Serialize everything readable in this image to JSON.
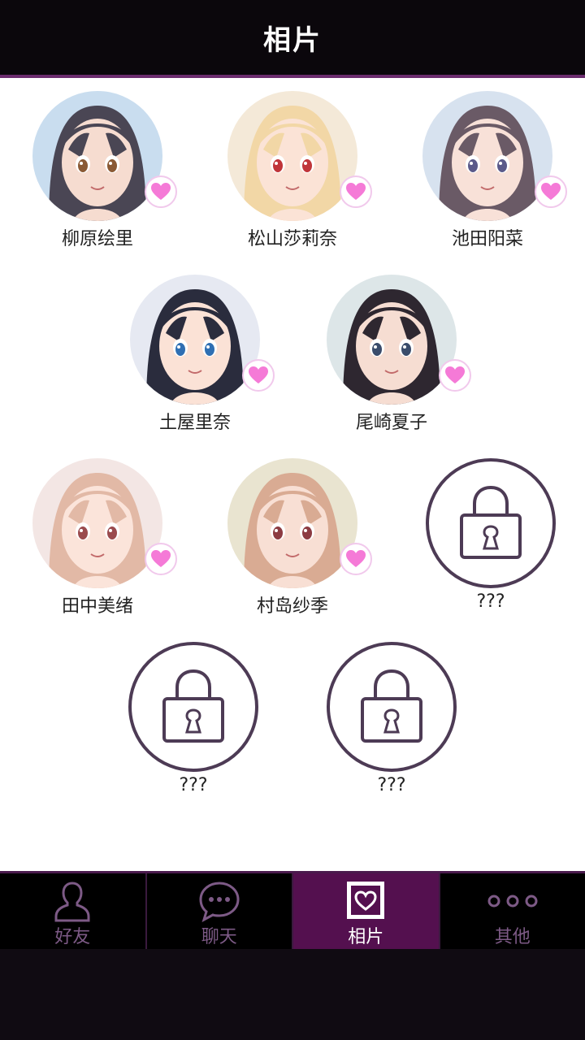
{
  "header": {
    "title": "相片"
  },
  "characters": [
    {
      "name": "柳原绘里",
      "locked": false,
      "hair": "#4a4654",
      "skin": "#f6dcd0",
      "bg": "#c9ddef",
      "eye": "#8a5a35"
    },
    {
      "name": "松山莎莉奈",
      "locked": false,
      "hair": "#f2d7a6",
      "skin": "#fbe3d6",
      "bg": "#f4e9d8",
      "eye": "#c0353a"
    },
    {
      "name": "池田阳菜",
      "locked": false,
      "hair": "#6a5a66",
      "skin": "#f8e1d8",
      "bg": "#d7e2ef",
      "eye": "#5b5a8a"
    },
    {
      "name": "土屋里奈",
      "locked": false,
      "hair": "#2a2c3d",
      "skin": "#fbe2d6",
      "bg": "#e6e9f2",
      "eye": "#2f6fb3"
    },
    {
      "name": "尾崎夏子",
      "locked": false,
      "hair": "#2e2730",
      "skin": "#f6ddd2",
      "bg": "#dde6e8",
      "eye": "#3a4c6b"
    },
    {
      "name": "田中美绪",
      "locked": false,
      "hair": "#e2b9a6",
      "skin": "#fbe4da",
      "bg": "#f3e6e4",
      "eye": "#9a4b4e"
    },
    {
      "name": "村岛纱季",
      "locked": false,
      "hair": "#d9ab93",
      "skin": "#f8dfd4",
      "bg": "#e9e4d0",
      "eye": "#8c3b42"
    },
    {
      "name": "???",
      "locked": true
    },
    {
      "name": "???",
      "locked": true
    },
    {
      "name": "???",
      "locked": true
    }
  ],
  "tabs": [
    {
      "label": "好友",
      "icon": "friend-icon",
      "active": false
    },
    {
      "label": "聊天",
      "icon": "chat-bubble-icon",
      "active": false
    },
    {
      "label": "相片",
      "icon": "photo-heart-icon",
      "active": true
    },
    {
      "label": "其他",
      "icon": "more-dots-icon",
      "active": false
    }
  ],
  "colors": {
    "accent": "#54104f",
    "header_bg": "#0b070c",
    "heart": "#f57ad7",
    "lock": "#4d3b55"
  }
}
